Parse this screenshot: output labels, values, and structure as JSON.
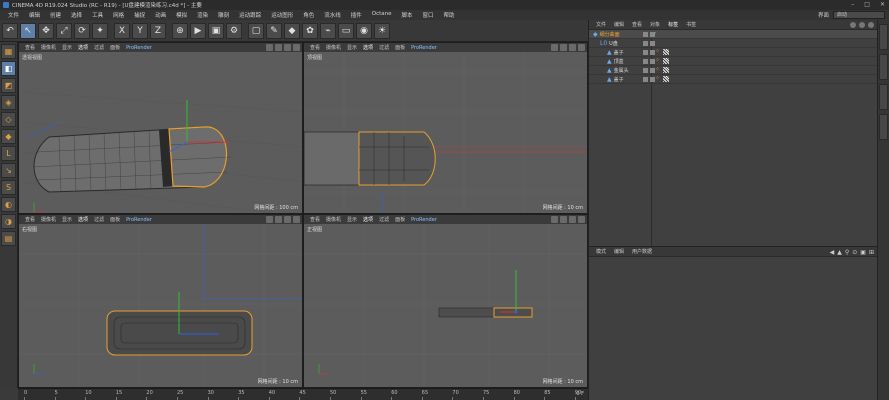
{
  "window": {
    "title": "CINEMA 4D R19.024 Studio (RC - R19) - [U盘建模渲染练习.c4d *] - 主要",
    "controls": [
      "–",
      "□",
      "✕"
    ]
  },
  "menubar": {
    "items": [
      "文件",
      "编辑",
      "创建",
      "选择",
      "工具",
      "网格",
      "捕捉",
      "动画",
      "模拟",
      "渲染",
      "雕刻",
      "运动跟踪",
      "运动图形",
      "角色",
      "流水线",
      "插件",
      "Octane",
      "脚本",
      "窗口",
      "帮助"
    ],
    "layout_label": "界面",
    "layout_value": "启动"
  },
  "toolbar": {
    "icons": [
      "undo-icon",
      "select-arrow-icon",
      "move-icon",
      "scale-icon",
      "rotate-icon",
      "recent-tools-icon",
      "x-axis-icon",
      "y-axis-icon",
      "z-axis-icon",
      "coordinate-system-icon",
      "render-view-icon",
      "render-picture-viewer-icon",
      "render-settings-icon",
      "cube-icon",
      "pen-icon",
      "subdivision-icon",
      "cloner-icon",
      "deformer-icon",
      "floor-icon",
      "camera-icon",
      "light-icon"
    ],
    "glyphs": [
      "↶",
      "↖",
      "✥",
      "⤢",
      "⟳",
      "✦",
      "X",
      "Y",
      "Z",
      "⊕",
      "▶",
      "▣",
      "⚙",
      "▢",
      "✎",
      "◆",
      "✿",
      "⌁",
      "▭",
      "◉",
      "☀"
    ]
  },
  "lefttools": {
    "icons": [
      "make-editable-icon",
      "model-mode-icon",
      "texture-mode-icon",
      "points-mode-icon",
      "edges-mode-icon",
      "polygons-mode-icon",
      "axis-mode-icon",
      "snap-icon",
      "workplane-icon",
      "solo-icon",
      "lock-icon",
      "grid-icon"
    ],
    "glyphs": [
      "▦",
      "◧",
      "◩",
      "◈",
      "◇",
      "◆",
      "L",
      "↘",
      "S",
      "◐",
      "◑",
      "▤"
    ]
  },
  "viewports": [
    {
      "name": "透视视图",
      "grid": "网格间距 : 100 cm",
      "menu": [
        "查看",
        "摄像机",
        "显示",
        "选项",
        "过滤",
        "面板",
        "ProRender"
      ],
      "active_menu": "选项"
    },
    {
      "name": "顶视图",
      "grid": "网格间距 : 10 cm",
      "menu": [
        "查看",
        "摄像机",
        "显示",
        "选项",
        "过滤",
        "面板",
        "ProRender"
      ],
      "active_menu": "选项"
    },
    {
      "name": "右视图",
      "grid": "网格间距 : 10 cm",
      "menu": [
        "查看",
        "摄像机",
        "显示",
        "选项",
        "过滤",
        "面板",
        "ProRender"
      ],
      "active_menu": "选项"
    },
    {
      "name": "正视图",
      "grid": "网格间距 : 10 cm",
      "menu": [
        "查看",
        "摄像机",
        "显示",
        "选项",
        "过滤",
        "面板",
        "ProRender"
      ],
      "active_menu": "选项"
    }
  ],
  "timeline": {
    "ticks": [
      "0",
      "5",
      "10",
      "15",
      "20",
      "25",
      "30",
      "35",
      "40",
      "45",
      "50",
      "55",
      "60",
      "65",
      "70",
      "75",
      "80",
      "85",
      "90"
    ],
    "frame": "0 F"
  },
  "object_manager": {
    "menu": [
      "文件",
      "编辑",
      "查看",
      "对象",
      "标签",
      "书签"
    ],
    "active_menu": "标签",
    "rows": [
      {
        "name": "细分曲面",
        "depth": 0,
        "icon": "subdivision-icon",
        "glyph": "◆",
        "selected": true,
        "check": "✓"
      },
      {
        "name": "U盘",
        "depth": 1,
        "icon": "null-icon",
        "glyph": "L0",
        "selected": false,
        "check": ""
      },
      {
        "name": "盖子",
        "depth": 2,
        "icon": "polygon-icon",
        "glyph": "▲",
        "selected": false,
        "check": ""
      },
      {
        "name": "顶盒",
        "depth": 2,
        "icon": "polygon-icon",
        "glyph": "▲",
        "selected": false,
        "check": ""
      },
      {
        "name": "金属头",
        "depth": 2,
        "icon": "polygon-icon",
        "glyph": "▲",
        "selected": false,
        "check": ""
      },
      {
        "name": "盖子",
        "depth": 2,
        "icon": "polygon-icon",
        "glyph": "▲",
        "selected": false,
        "check": ""
      }
    ]
  },
  "attribute_manager": {
    "menu": [
      "模式",
      "编辑",
      "用户数据"
    ],
    "nav": [
      "◀",
      "▲",
      "⚲",
      "⊙",
      "▣",
      "⊞"
    ]
  },
  "colors": {
    "accent": "#5e7fa8",
    "selection": "#f0a030",
    "x_axis": "#e03030",
    "y_axis": "#30c030",
    "z_axis": "#3060e0"
  }
}
